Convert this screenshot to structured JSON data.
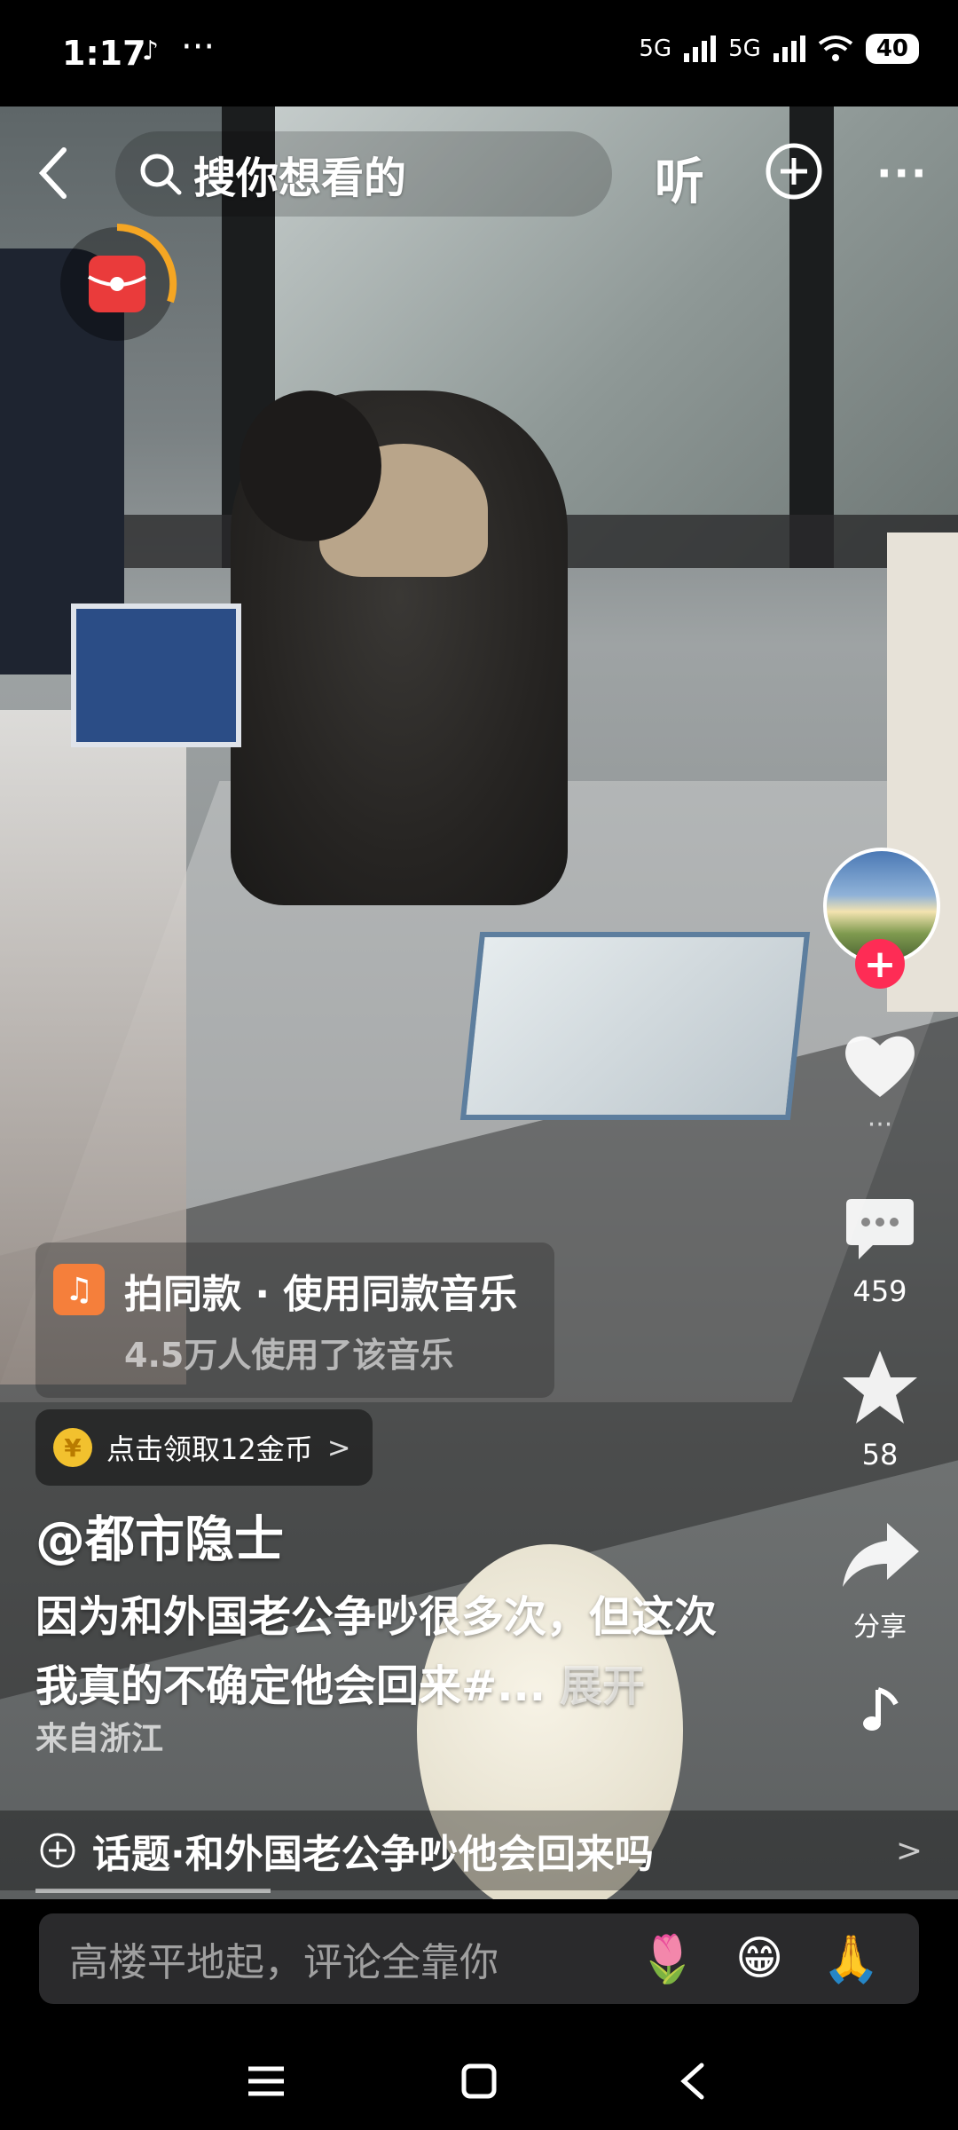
{
  "status_bar": {
    "time": "1:17",
    "app_icon": "tiktok-icon",
    "more": "···",
    "network1": "5G",
    "network2": "5G",
    "battery": "40"
  },
  "top_bar": {
    "search_placeholder": "搜你想看的",
    "listen_label": "听"
  },
  "right_column": {
    "like_count": "···",
    "comment_count": "459",
    "favorite_count": "58",
    "share_label": "分享"
  },
  "music": {
    "line1": "拍同款 · 使用同款音乐",
    "line2": "4.5万人使用了该音乐"
  },
  "coin_promo": {
    "text": "点击领取12金币",
    "chevron": ">"
  },
  "post": {
    "author": "@都市隐士",
    "desc_line1": "因为和外国老公争吵很多次，但这次",
    "desc_line2": "我真的不确定他会回来#...",
    "expand_label": "展开",
    "location": "来自浙江"
  },
  "topic": {
    "text": "话题·和外国老公争吵他会回来吗",
    "chevron": ">"
  },
  "comment_bar": {
    "placeholder": "高楼平地起，评论全靠你",
    "emojis": [
      "🌷",
      "😁",
      "🙏"
    ]
  },
  "colors": {
    "accent_red": "#fe2c55",
    "music_badge": "#f57f3b",
    "coin": "#f2c12e"
  }
}
